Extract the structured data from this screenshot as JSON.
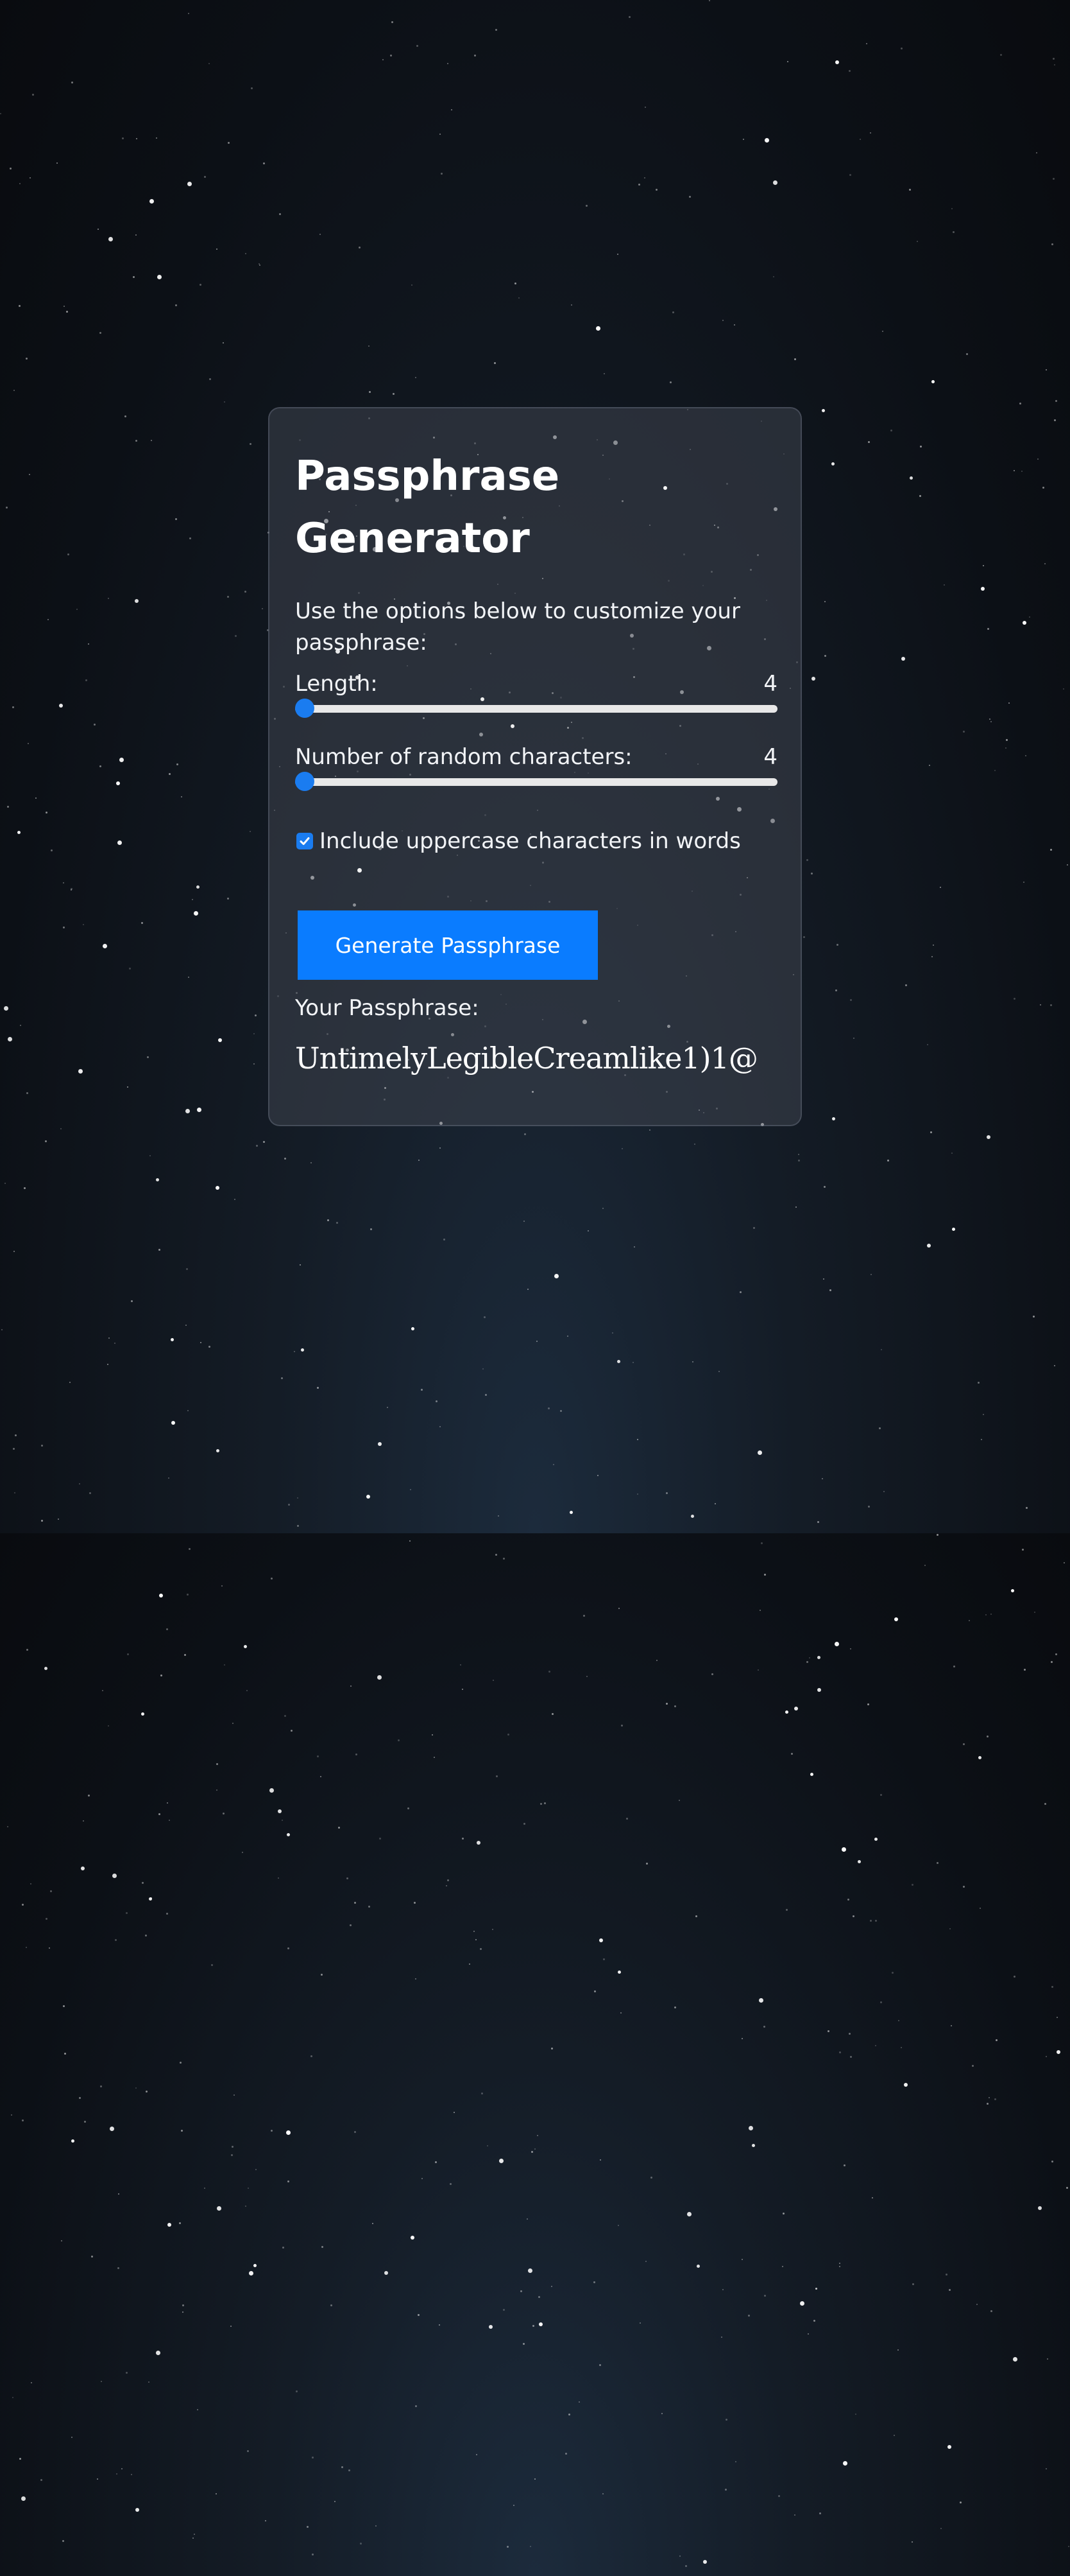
{
  "app": {
    "title": "Passphrase Generator",
    "description": "Use the options below to customize your passphrase:"
  },
  "length": {
    "label": "Length:",
    "value": "4",
    "slider_fraction": 0.0
  },
  "random_chars": {
    "label": "Number of random characters:",
    "value": "4",
    "slider_fraction": 0.0
  },
  "uppercase": {
    "label": "Include uppercase characters in words",
    "checked": true
  },
  "generate_button": {
    "label": "Generate Passphrase"
  },
  "result": {
    "label": "Your Passphrase:",
    "value": "UntimelyLegibleCreamlike1)1@"
  },
  "colors": {
    "accent": "#0a7cff",
    "background": "#0c1016",
    "card": "#2e333b",
    "text": "#ffffff"
  }
}
